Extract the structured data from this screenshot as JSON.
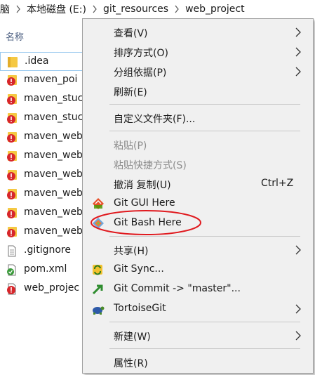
{
  "breadcrumb": {
    "items": [
      "脑",
      "本地磁盘 (E:)",
      "git_resources",
      "web_project"
    ]
  },
  "explorer": {
    "column_header": "名称",
    "files": [
      {
        "name": ".idea",
        "icon": "folder-icon"
      },
      {
        "name": "maven_poi",
        "icon": "git-conflict-folder-icon"
      },
      {
        "name": "maven_stuc",
        "icon": "git-conflict-folder-icon"
      },
      {
        "name": "maven_stuc",
        "icon": "git-conflict-folder-icon"
      },
      {
        "name": "maven_web",
        "icon": "git-conflict-folder-icon"
      },
      {
        "name": "maven_web",
        "icon": "git-conflict-folder-icon"
      },
      {
        "name": "maven_web",
        "icon": "git-conflict-folder-icon"
      },
      {
        "name": "maven_web",
        "icon": "git-conflict-folder-icon"
      },
      {
        "name": "maven_web",
        "icon": "git-conflict-folder-icon"
      },
      {
        "name": "maven_web",
        "icon": "git-conflict-folder-icon"
      },
      {
        "name": ".gitignore",
        "icon": "text-file-icon"
      },
      {
        "name": "pom.xml",
        "icon": "xml-file-icon"
      },
      {
        "name": "web_projec",
        "icon": "git-conflict-file-icon"
      }
    ]
  },
  "context_menu": {
    "view": "查看(V)",
    "sort_by": "排序方式(O)",
    "group_by": "分组依据(P)",
    "refresh": "刷新(E)",
    "customize_folder": "自定义文件夹(F)...",
    "paste": "粘贴(P)",
    "paste_shortcut": "粘贴快捷方式(S)",
    "undo_copy": "撤消 复制(U)",
    "undo_copy_shortcut": "Ctrl+Z",
    "git_gui": "Git GUI Here",
    "git_bash": "Git Bash Here",
    "share": "共享(H)",
    "git_sync": "Git Sync...",
    "git_commit": "Git Commit -> \"master\"...",
    "tortoisegit": "TortoiseGit",
    "new": "新建(W)",
    "properties": "属性(R)"
  },
  "colors": {
    "menu_bg": "#f0f0f0",
    "annotation_red": "#e0191e",
    "git_conflict_red": "#d7262b",
    "folder_yellow": "#f5c842"
  }
}
